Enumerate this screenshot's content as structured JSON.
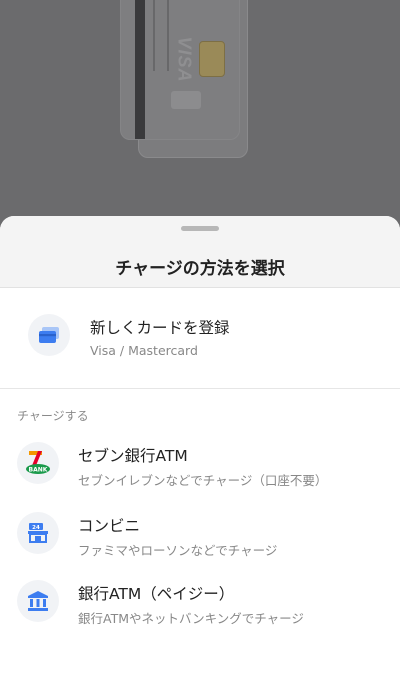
{
  "sheet": {
    "title": "チャージの方法を選択"
  },
  "register_card": {
    "title": "新しくカードを登録",
    "subtitle": "Visa / Mastercard",
    "icon": "credit-card-icon"
  },
  "charge_section": {
    "label": "チャージする",
    "items": [
      {
        "title": "セブン銀行ATM",
        "subtitle": "セブンイレブンなどでチャージ（口座不要）",
        "icon": "seven-bank-logo-icon"
      },
      {
        "title": "コンビニ",
        "subtitle": "ファミマやローソンなどでチャージ",
        "icon": "convenience-store-icon"
      },
      {
        "title": "銀行ATM（ペイジー）",
        "subtitle": "銀行ATMやネットバンキングでチャージ",
        "icon": "bank-icon"
      }
    ]
  },
  "background_card": {
    "brand": "VISA"
  },
  "colors": {
    "accent_blue": "#3d7df0",
    "icon_bg": "#f1f3f6",
    "seven_green": "#1a9a4b",
    "seven_orange": "#f39800",
    "seven_red": "#e4002b"
  }
}
